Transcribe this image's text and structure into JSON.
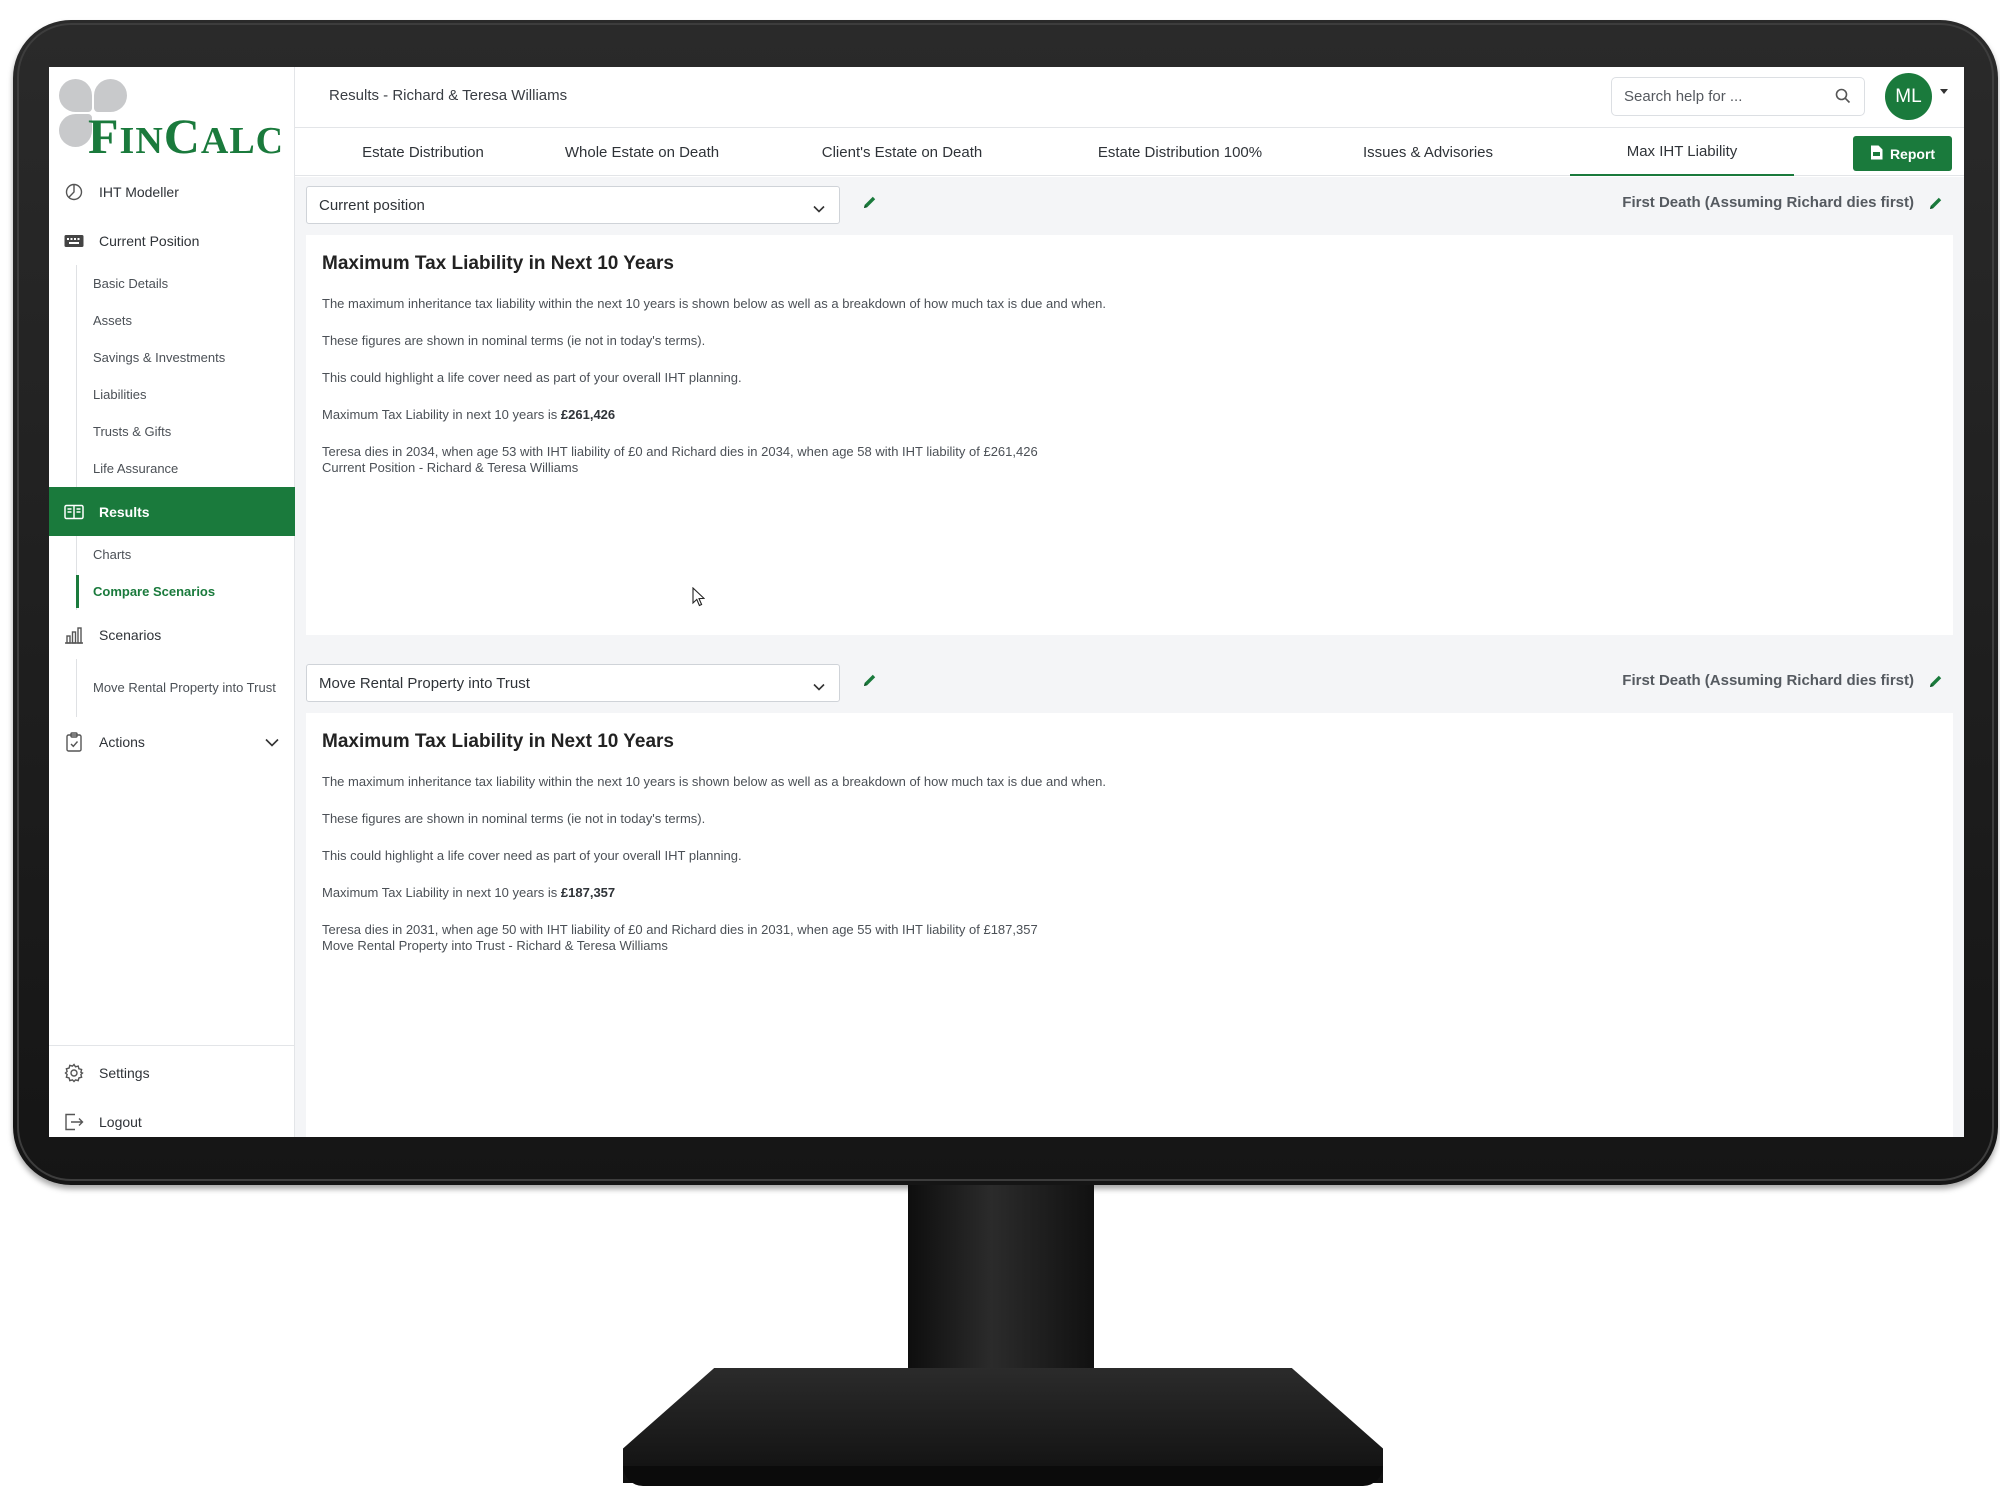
{
  "app": {
    "logo_text_f": "F",
    "logo_text_in": "IN",
    "logo_text_c": "C",
    "logo_text_alc": "ALC",
    "brand_color": "#1a7a3c"
  },
  "sidebar": {
    "items": [
      {
        "label": "IHT Modeller",
        "icon": "pie-chart-icon"
      },
      {
        "label": "Current Position",
        "icon": "keyboard-icon"
      },
      {
        "label": "Results",
        "icon": "results-icon"
      },
      {
        "label": "Scenarios",
        "icon": "bar-chart-icon"
      },
      {
        "label": "Actions",
        "icon": "clipboard-icon"
      }
    ],
    "current_position_sub": [
      "Basic Details",
      "Assets",
      "Savings & Investments",
      "Liabilities",
      "Trusts & Gifts",
      "Life Assurance"
    ],
    "results_sub": [
      "Charts",
      "Compare Scenarios"
    ],
    "scenarios_sub": [
      "Move Rental Property into Trust"
    ],
    "bottom": [
      {
        "label": "Settings",
        "icon": "gear-icon"
      },
      {
        "label": "Logout",
        "icon": "logout-icon"
      }
    ]
  },
  "header": {
    "title": "Results - Richard & Teresa Williams",
    "search_placeholder": "Search help for ...",
    "avatar_initials": "ML"
  },
  "tabs": [
    {
      "label": "Estate Distribution"
    },
    {
      "label": "Whole Estate on Death"
    },
    {
      "label": "Client's Estate on Death"
    },
    {
      "label": "Estate Distribution 100%"
    },
    {
      "label": "Issues & Advisories"
    },
    {
      "label": "Max IHT Liability",
      "active": true
    }
  ],
  "report_label": "Report",
  "scenarios": [
    {
      "select_value": "Current position",
      "death_label": "First Death (Assuming Richard dies first)",
      "heading": "Maximum Tax Liability in Next 10 Years",
      "p1": "The maximum inheritance tax liability within the next 10 years is shown below as well as a breakdown of how much tax is due and when.",
      "p2": "These figures are shown in nominal terms (ie not in today's terms).",
      "p3": "This could highlight a life cover need as part of your overall IHT planning.",
      "max_prefix": "Maximum Tax Liability in next 10 years is ",
      "max_value": "£261,426",
      "detail": "Teresa dies in 2034, when age 53 with IHT liability of £0 and Richard dies in 2034, when age 58 with IHT liability of £261,426",
      "caption": "Current Position - Richard & Teresa Williams"
    },
    {
      "select_value": "Move Rental Property into Trust",
      "death_label": "First Death (Assuming Richard dies first)",
      "heading": "Maximum Tax Liability in Next 10 Years",
      "p1": "The maximum inheritance tax liability within the next 10 years is shown below as well as a breakdown of how much tax is due and when.",
      "p2": "These figures are shown in nominal terms (ie not in today's terms).",
      "p3": "This could highlight a life cover need as part of your overall IHT planning.",
      "max_prefix": "Maximum Tax Liability in next 10 years is ",
      "max_value": "£187,357",
      "detail": "Teresa dies in 2031, when age 50 with IHT liability of £0 and Richard dies in 2031, when age 55 with IHT liability of £187,357",
      "caption": "Move Rental Property into Trust - Richard & Teresa Williams"
    }
  ]
}
